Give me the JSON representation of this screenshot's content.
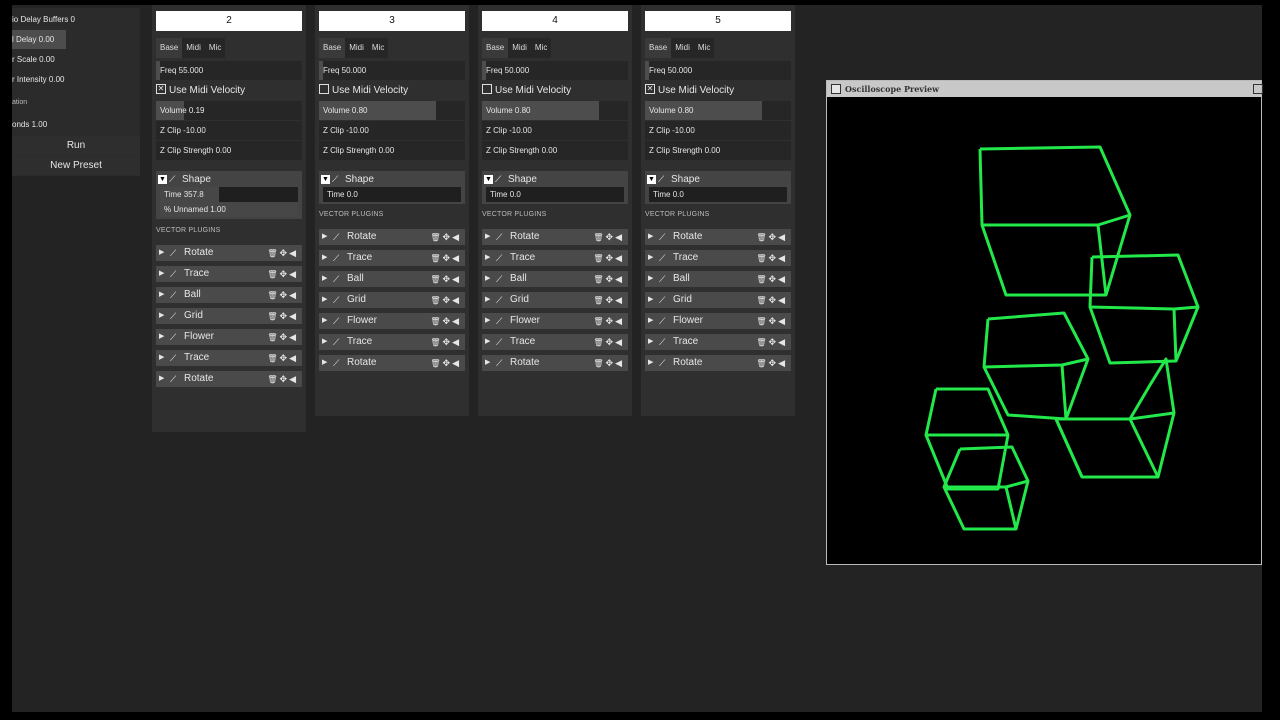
{
  "left_panel": {
    "rows": [
      {
        "label": "io Delay Buffers 0",
        "fill": 0
      },
      {
        "label": "l Delay 0.00",
        "fill": 0.42
      },
      {
        "label": "r Scale 0.00",
        "fill": 0
      },
      {
        "label": "r Intensity 0.00",
        "fill": 0
      },
      {
        "label": "ation",
        "fill": 0
      },
      {
        "label": "onds 1.00",
        "fill": 0
      }
    ],
    "run_label": "Run",
    "new_preset_label": "New Preset"
  },
  "columns": [
    {
      "number": "2",
      "tabs": [
        "Base",
        "Midi",
        "Mic"
      ],
      "freq": {
        "label": "Freq 55.000",
        "fill": 0.03
      },
      "use_midi_velocity": {
        "label": "Use Midi Velocity",
        "checked": true
      },
      "volume": {
        "label": "Volume 0.19",
        "fill": 0.19
      },
      "z_clip": {
        "label": "Z Clip -10.00",
        "fill": 0
      },
      "z_clip_strength": {
        "label": "Z Clip Strength 0.00",
        "fill": 0
      },
      "shape": {
        "label": "Shape",
        "time": {
          "label": "Time 357.8",
          "fill": 0.43
        },
        "extra": {
          "label": "% Unnamed 1.00",
          "fill": 1.0
        }
      },
      "vector_plugins_label": "VECTOR PLUGINS",
      "plugins": [
        "Rotate",
        "Trace",
        "Ball",
        "Grid",
        "Flower",
        "Trace",
        "Rotate"
      ]
    },
    {
      "number": "3",
      "tabs": [
        "Base",
        "Midi",
        "Mic"
      ],
      "freq": {
        "label": "Freq 50.000",
        "fill": 0.03
      },
      "use_midi_velocity": {
        "label": "Use Midi Velocity",
        "checked": false
      },
      "volume": {
        "label": "Volume 0.80",
        "fill": 0.8
      },
      "z_clip": {
        "label": "Z Clip -10.00",
        "fill": 0
      },
      "z_clip_strength": {
        "label": "Z Clip Strength 0.00",
        "fill": 0
      },
      "shape": {
        "label": "Shape",
        "time": {
          "label": "Time 0.0",
          "fill": 0
        }
      },
      "vector_plugins_label": "VECTOR PLUGINS",
      "plugins": [
        "Rotate",
        "Trace",
        "Ball",
        "Grid",
        "Flower",
        "Trace",
        "Rotate"
      ]
    },
    {
      "number": "4",
      "tabs": [
        "Base",
        "Midi",
        "Mic"
      ],
      "freq": {
        "label": "Freq 50.000",
        "fill": 0.03
      },
      "use_midi_velocity": {
        "label": "Use Midi Velocity",
        "checked": false
      },
      "volume": {
        "label": "Volume 0.80",
        "fill": 0.8
      },
      "z_clip": {
        "label": "Z Clip -10.00",
        "fill": 0
      },
      "z_clip_strength": {
        "label": "Z Clip Strength 0.00",
        "fill": 0
      },
      "shape": {
        "label": "Shape",
        "time": {
          "label": "Time 0.0",
          "fill": 0
        }
      },
      "vector_plugins_label": "VECTOR PLUGINS",
      "plugins": [
        "Rotate",
        "Trace",
        "Ball",
        "Grid",
        "Flower",
        "Trace",
        "Rotate"
      ]
    },
    {
      "number": "5",
      "tabs": [
        "Base",
        "Midi",
        "Mic"
      ],
      "freq": {
        "label": "Freq 50.000",
        "fill": 0.03
      },
      "use_midi_velocity": {
        "label": "Use Midi Velocity",
        "checked": true
      },
      "volume": {
        "label": "Volume 0.80",
        "fill": 0.8
      },
      "z_clip": {
        "label": "Z Clip -10.00",
        "fill": 0
      },
      "z_clip_strength": {
        "label": "Z Clip Strength 0.00",
        "fill": 0
      },
      "shape": {
        "label": "Shape",
        "time": {
          "label": "Time 0.0",
          "fill": 0
        }
      },
      "vector_plugins_label": "VECTOR PLUGINS",
      "plugins": [
        "Rotate",
        "Trace",
        "Ball",
        "Grid",
        "Flower",
        "Trace",
        "Rotate"
      ]
    }
  ],
  "oscilloscope": {
    "title": "Oscilloscope Preview",
    "trace_color": "#22e84a",
    "background": "#000000"
  },
  "icons": {
    "plugin_expand": "chevron-right-icon",
    "plugin_wand": "wand-icon",
    "delete": "trash-icon",
    "move": "move-icon",
    "collapse": "chevron-left-icon",
    "shape_toggle": "chevron-down-icon"
  }
}
